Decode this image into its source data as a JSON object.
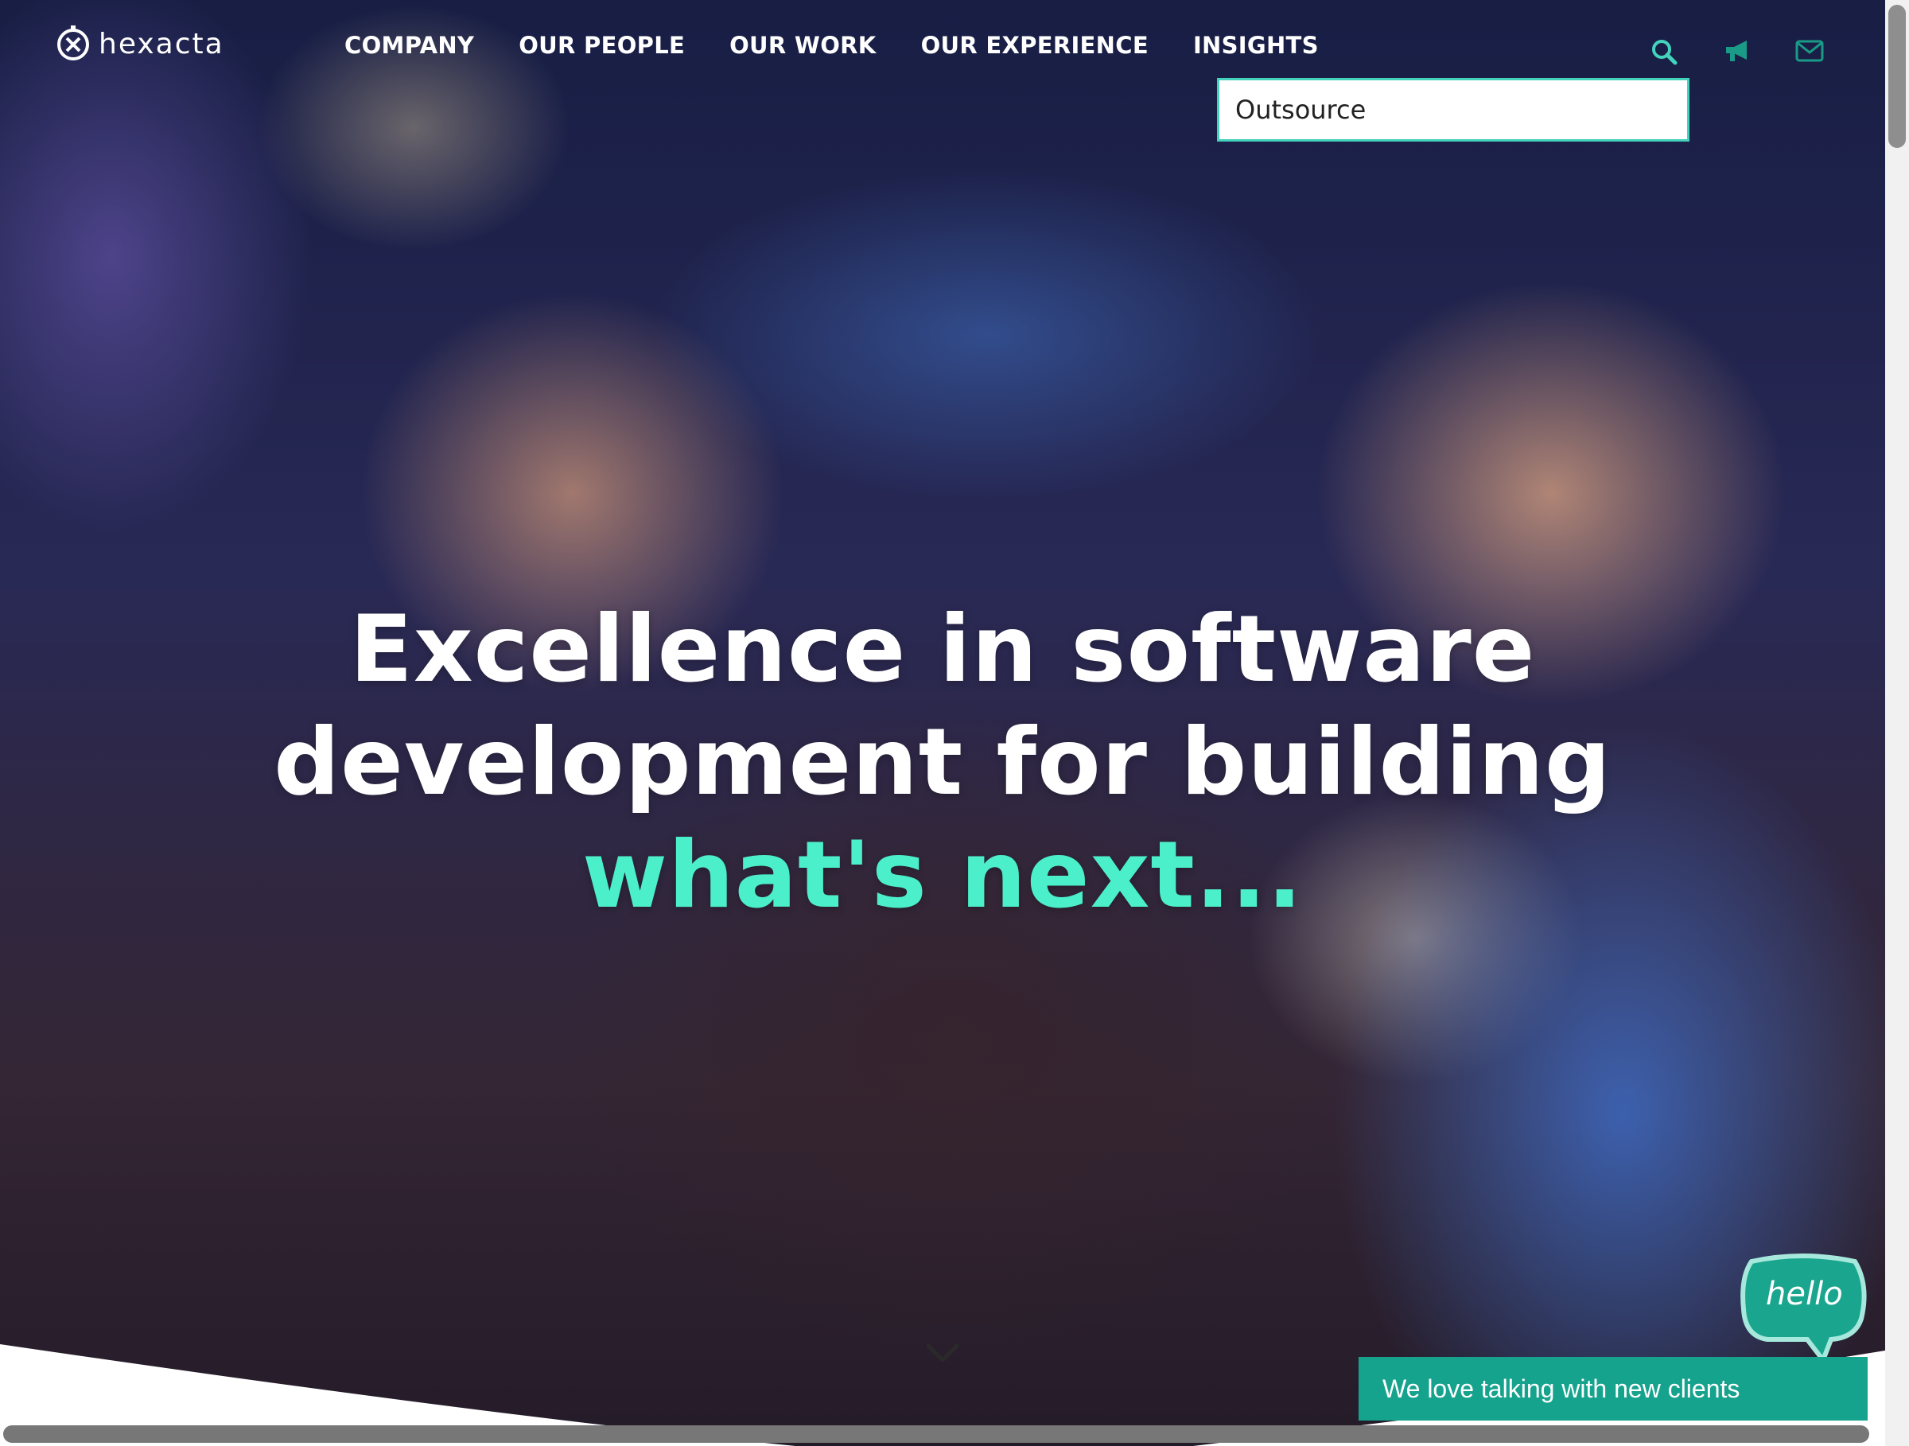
{
  "logo": {
    "text": "hexacta",
    "icon": "hexacta-logo-icon"
  },
  "nav": {
    "items": [
      {
        "label": "COMPANY"
      },
      {
        "label": "OUR PEOPLE"
      },
      {
        "label": "OUR WORK"
      },
      {
        "label": "OUR EXPERIENCE"
      },
      {
        "label": "INSIGHTS"
      }
    ]
  },
  "header_icons": [
    "search-icon",
    "megaphone-icon",
    "mail-icon"
  ],
  "search": {
    "value": "Outsource"
  },
  "hero": {
    "line1": "Excellence in software",
    "line2": "development for building",
    "accent": "what's next..."
  },
  "chat": {
    "bubble_text": "hello",
    "banner_text": "We love talking with new clients"
  },
  "colors": {
    "accent": "#4bf0cb",
    "search_border": "#43d3bd",
    "chat_green": "#16a38e"
  }
}
